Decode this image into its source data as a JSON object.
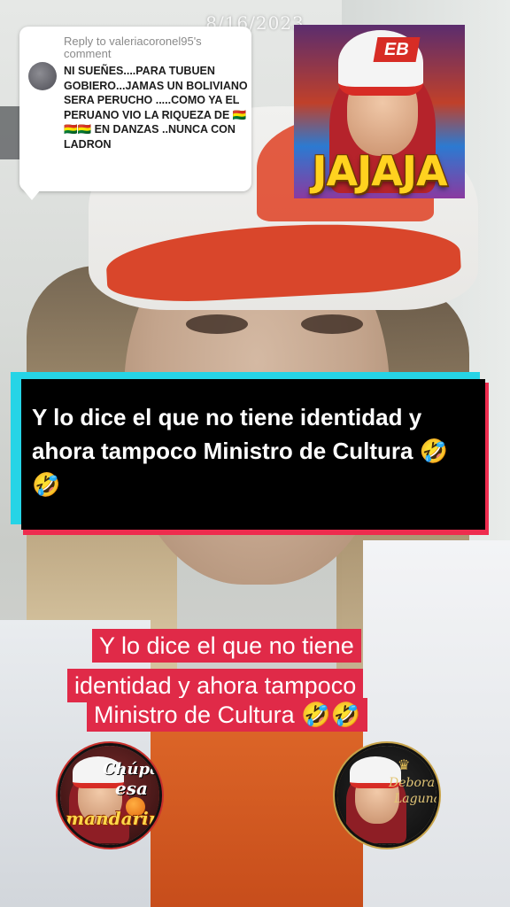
{
  "date_watermark": "8/16/2023",
  "reply_bubble": {
    "header": "Reply to valeriacoronel95's comment",
    "body": "NI SUEÑES....PARA TUBUEN GOBIERO...JAMAS UN BOLIVIANO SERA PERUCHO .....COMO YA EL PERUANO VIO LA RIQUEZA DE 🇧🇴🇧🇴🇧🇴 EN DANZAS ..NUNCA CON LADRON"
  },
  "sticker": {
    "cap_text": "EB",
    "word": "JAJAJA"
  },
  "caption_black": {
    "text": "Y lo dice el que no tiene identidad y ahora tampoco Ministro de Cultura 🤣🤣"
  },
  "caption_red": {
    "line1": "Y lo dice el que no tiene",
    "line2": "identidad y ahora tampoco",
    "line3": "Ministro de Cultura 🤣🤣"
  },
  "logo_left": {
    "line1": "Chúpate",
    "line2": "esa",
    "line3": "mandarina"
  },
  "logo_right": {
    "name1": "Debora",
    "name2": "Laguna"
  },
  "colors": {
    "caption_red_bg": "#e02a48",
    "caption_black_bg": "#000000",
    "glitch_cyan": "#26d4e6",
    "glitch_red": "#ee2c4e",
    "sticker_text": "#ffd21f"
  }
}
